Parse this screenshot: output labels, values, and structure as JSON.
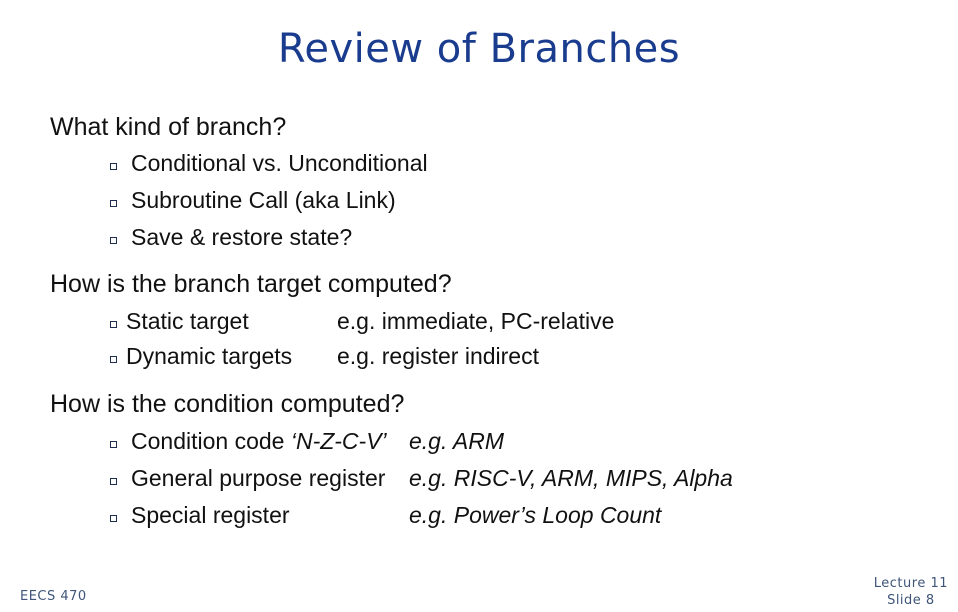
{
  "slide": {
    "title": "Review of Branches",
    "sections": [
      {
        "heading": "What kind of branch?",
        "items": [
          {
            "text": "Conditional vs. Unconditional"
          },
          {
            "text": "Subroutine Call (aka Link)"
          },
          {
            "text": "Save & restore state?"
          }
        ]
      },
      {
        "heading": "How is the branch target computed?",
        "items": [
          {
            "text": "Static target",
            "example": "e.g. immediate, PC-relative"
          },
          {
            "text": "Dynamic targets",
            "example": "e.g. register indirect"
          }
        ]
      },
      {
        "heading": "How is the condition computed?",
        "items": [
          {
            "text_prefix": "Condition code ",
            "text_italic": "‘N-Z-C-V’",
            "example": "e.g. ARM"
          },
          {
            "text": "General purpose register",
            "example": "e.g. RISC-V, ARM, MIPS, Alpha"
          },
          {
            "text": "Special register",
            "example": "e.g. Power’s Loop Count"
          }
        ]
      }
    ],
    "bullet_icon": "hollow-square-bullet"
  },
  "footer": {
    "course": "EECS 470",
    "lecture": "Lecture 11",
    "slide": "Slide 8"
  },
  "colors": {
    "title": "#1a3c8e",
    "footer": "#3f5679"
  }
}
